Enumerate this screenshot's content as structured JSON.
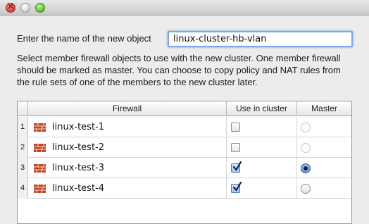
{
  "form": {
    "name_label": "Enter the name of the new object",
    "name_value": "linux-cluster-hb-vlan",
    "description": "Select member firewall objects to use with the new cluster. One member firewall should be marked as master. You can choose to copy policy and NAT rules from the rule sets of one of the members to the new cluster later."
  },
  "table": {
    "columns": [
      "Firewall",
      "Use in cluster",
      "Master"
    ],
    "rows": [
      {
        "num": "1",
        "firewall": "linux-test-1",
        "use_in_cluster": false,
        "master": false,
        "master_enabled": false
      },
      {
        "num": "2",
        "firewall": "linux-test-2",
        "use_in_cluster": false,
        "master": false,
        "master_enabled": false
      },
      {
        "num": "3",
        "firewall": "linux-test-3",
        "use_in_cluster": true,
        "master": true,
        "master_enabled": true
      },
      {
        "num": "4",
        "firewall": "linux-test-4",
        "use_in_cluster": true,
        "master": false,
        "master_enabled": true
      }
    ]
  },
  "colors": {
    "firewall_icon": "#c0462a",
    "focus_ring": "#7fa9e0",
    "checked_fill": "#a9c6ef"
  },
  "icons": {
    "row_icon": "firewall-brick-icon",
    "check": "checkmark-icon"
  }
}
